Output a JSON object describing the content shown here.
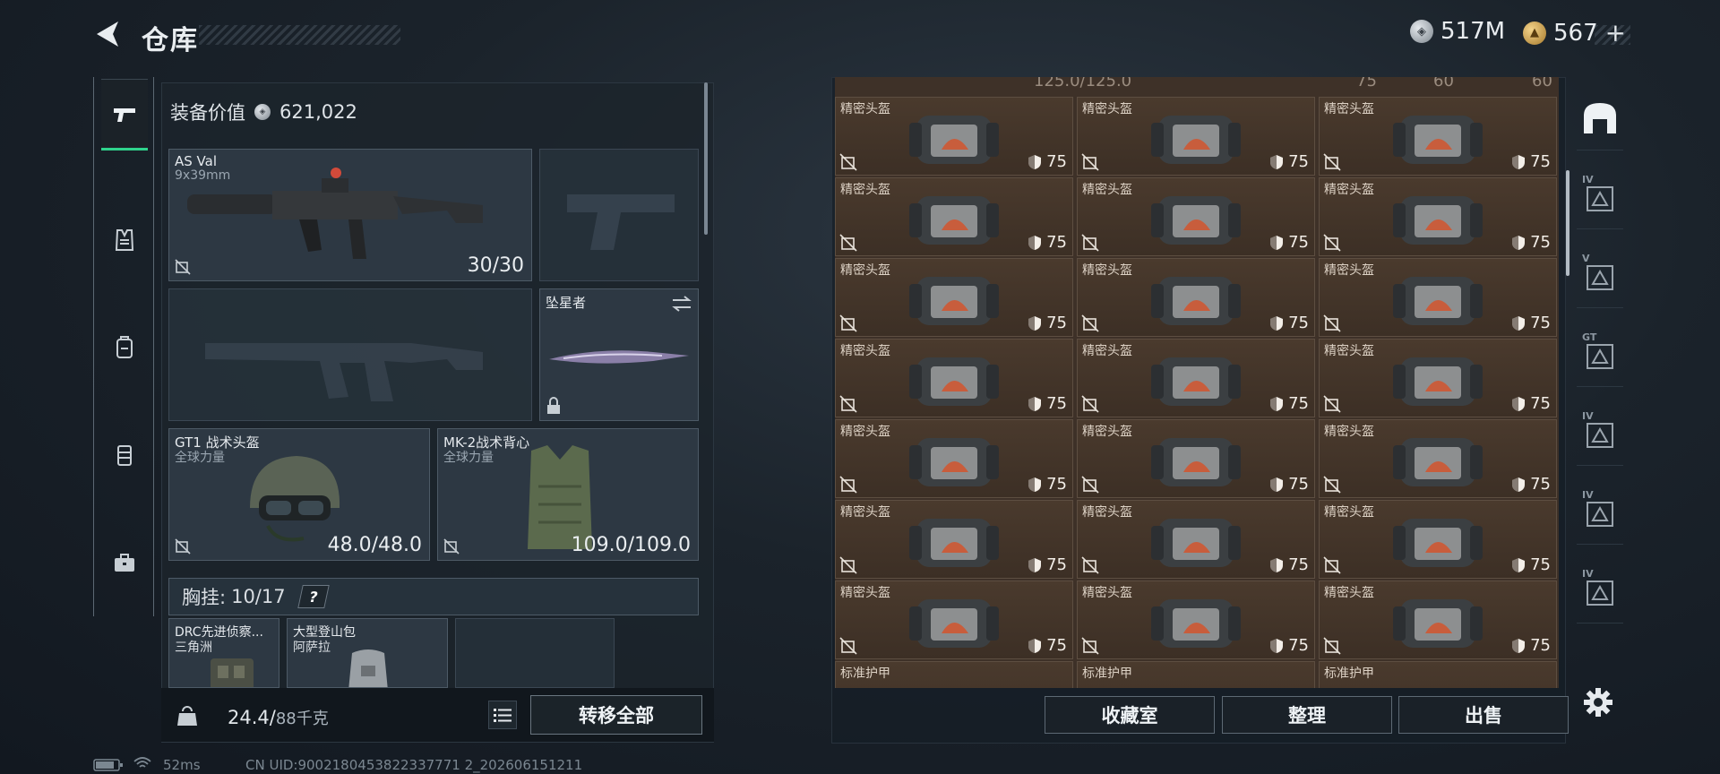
{
  "header": {
    "title": "仓库",
    "currency_silver": "517M",
    "currency_gold": "567",
    "gold_plus": "+"
  },
  "equipment": {
    "value_label": "装备价值",
    "value": "621,022",
    "primary": {
      "name": "AS Val",
      "caliber": "9x39mm",
      "ammo": "30/30"
    },
    "melee": {
      "name": "坠星者"
    },
    "helmet": {
      "name": "GT1 战术头盔",
      "faction": "全球力量",
      "durability": "48.0/48.0"
    },
    "armor": {
      "name": "MK-2战术背心",
      "faction": "全球力量",
      "durability": "109.0/109.0"
    },
    "chest_rig": {
      "label": "胸挂:",
      "capacity": "10/17",
      "help": "?"
    },
    "rig_slot": {
      "name": "DRC先进侦察...",
      "faction": "三角洲"
    },
    "backpack": {
      "name": "大型登山包",
      "faction": "阿萨拉"
    }
  },
  "carry": {
    "weight": "24.4/",
    "max": "88千克",
    "transfer_all": "转移全部"
  },
  "status_bar": {
    "ping": "52ms",
    "uid": "CN UID:9002180453822337771 2_202606151211"
  },
  "storage": {
    "header_durability": "125.0/125.0",
    "header_armor": "75",
    "header_val1": "60",
    "header_val2": "60",
    "item_name": "精密头盔",
    "item_armor": "75",
    "next_row_name": "标准护甲",
    "buttons": {
      "collection": "收藏室",
      "organize": "整理",
      "sell": "出售"
    }
  },
  "rail": {
    "tiers": [
      "IV",
      "V",
      "GT",
      "IV",
      "IV",
      "IV"
    ]
  },
  "colors": {
    "accent_green": "#2fd38c",
    "cell_brown": "#4a3a2d",
    "panel": "#1c242c"
  },
  "icons": {
    "sidebar": [
      "pistol-icon",
      "vest-icon",
      "backpack-icon",
      "rig-icon",
      "case-icon"
    ],
    "rail": [
      "helmet-filter-icon",
      "container-icon",
      "container-icon",
      "armor-icon",
      "armor-icon",
      "armor-icon",
      "armor-icon"
    ]
  }
}
